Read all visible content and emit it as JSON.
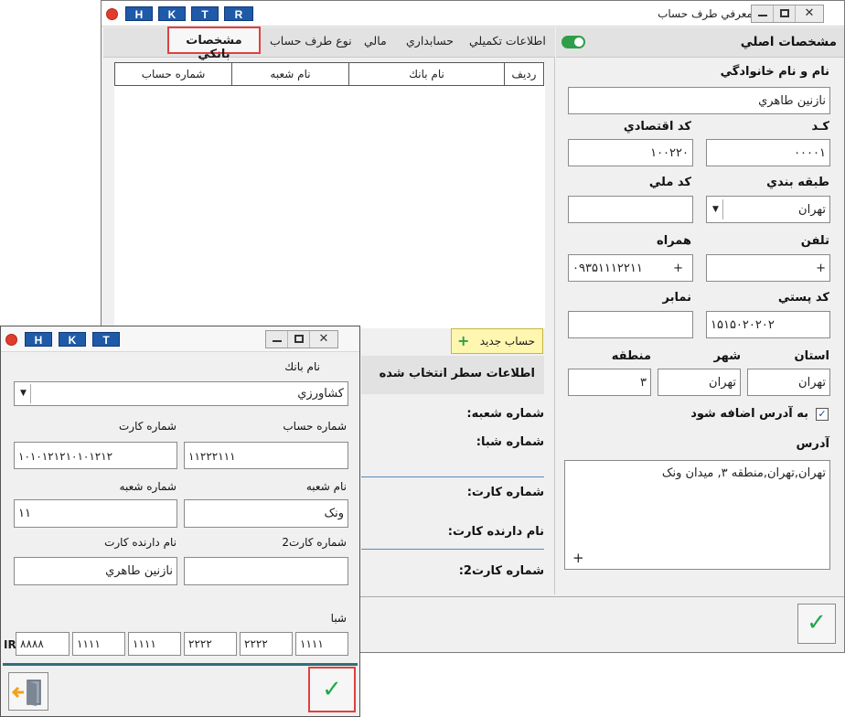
{
  "main": {
    "title": "معرفي طرف حساب",
    "hk_buttons": [
      "H",
      "K",
      "T",
      "R"
    ],
    "header": "مشخصات اصلي",
    "tabs": [
      "اطلاعات تكميلي",
      "حسابداري",
      "مالي",
      "نوع طرف حساب",
      "مشخصات بانكي"
    ],
    "grid_columns": [
      "رديف",
      "نام بانك",
      "نام شعبه",
      "شماره حساب"
    ],
    "new_account_label": "حساب جديد",
    "selected_row_header": "اطلاعات سطر انتخاب شده",
    "detail_labels": {
      "branch_no": "شماره شعبه:",
      "sheba_no": "شماره شبا:",
      "card_no": "شماره كارت:",
      "card_holder": "نام دارنده كارت:",
      "card_no2": "شماره كارت2:"
    },
    "form": {
      "name_label": "نام و نام خانوادگي",
      "name_value": "نازنين طاهري",
      "code_label": "كـد",
      "code_value": "۰۰۰۰۱",
      "econ_code_label": "كد اقتصادي",
      "econ_code_value": "۱۰۰۲۲۰",
      "category_label": "طبقه بندي",
      "category_value": "تهران",
      "national_code_label": "كد ملي",
      "national_code_value": "",
      "phone_label": "تلفن",
      "phone_value": "+",
      "mobile_label": "همراه",
      "mobile_value": "۰۹۳۵۱۱۱۲۲۱۱",
      "mobile_plus": "+",
      "postal_label": "كد پستي",
      "postal_value": "۱۵۱۵۰۲۰۲۰۲",
      "fax_label": "نمابر",
      "fax_value": "",
      "province_label": "استان",
      "province_value": "تهران",
      "city_label": "شهر",
      "city_value": "تهران",
      "region_label": "منطقه",
      "region_value": "۳",
      "add_to_address_label": "به آدرس اضافه شود",
      "add_to_address_checked": true,
      "address_label": "آدرس",
      "address_value": "تهران,تهران,منطقه ۳, ميدان ونک",
      "address_plus": "+"
    }
  },
  "sub": {
    "hk_buttons": [
      "H",
      "K",
      "T"
    ],
    "bank_name_label": "نام بانك",
    "bank_name_value": "كشاورزي",
    "account_no_label": "شماره حساب",
    "account_no_value": "۱۱۲۲۲۱۱۱",
    "card_no_label": "شماره كارت",
    "card_no_value": "۱۰۱۰۱۲۱۲۱۰۱۰۱۲۱۲",
    "branch_name_label": "نام شعبه",
    "branch_name_value": "ونک",
    "branch_code_label": "شماره شعبه",
    "branch_code_value": "۱۱",
    "card_no2_label": "شماره كارت2",
    "card_no2_value": "",
    "card_holder_label": "نام دارنده كارت",
    "card_holder_value": "نازنين طاهري",
    "sheba_label": "شبا",
    "sheba_prefix": "IR",
    "sheba_parts": [
      "۸۸۸۸",
      "۱۱۱۱",
      "۱۱۱۱",
      "۲۲۲۲",
      "۲۲۲۲",
      "۱۱۱۱"
    ]
  },
  "colors": {
    "hk_button": "#1e5aa8",
    "toggle": "#2e9e48",
    "ok_check": "#22a84a",
    "highlight_border": "#e04040",
    "new_button_bg": "#fff6b0"
  }
}
